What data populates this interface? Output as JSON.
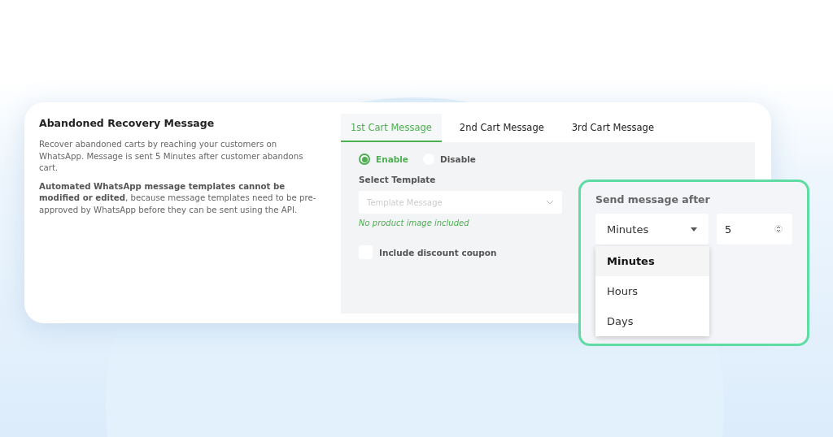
{
  "section": {
    "title": "Abandoned Recovery Message",
    "description": "Recover abandoned carts by reaching your customers on WhatsApp. Message is sent 5 Minutes after customer abandons cart.",
    "note": "**Automated WhatsApp message templates cannot be modified or edited**, because message templates need to be pre-approved by WhatsApp before they can be sent using the API."
  },
  "tabs": [
    {
      "label": "1st Cart Message",
      "selected": true
    },
    {
      "label": "2nd Cart Message",
      "selected": false
    },
    {
      "label": "3rd Cart Message",
      "selected": false
    }
  ],
  "status_options": [
    {
      "label": "Enable",
      "selected": true
    },
    {
      "label": "Disable",
      "selected": false
    }
  ],
  "template": {
    "label": "Select Template",
    "placeholder": "Template Message",
    "hint": "No product image included"
  },
  "discount_coupon": {
    "label": "Include discount coupon",
    "checked": false
  },
  "send_after": {
    "label": "Send message after",
    "unit": "Minutes",
    "amount": "5",
    "options": [
      {
        "label": "Minutes",
        "selected": true
      },
      {
        "label": "Hours",
        "selected": false
      },
      {
        "label": "Days",
        "selected": false
      }
    ]
  }
}
